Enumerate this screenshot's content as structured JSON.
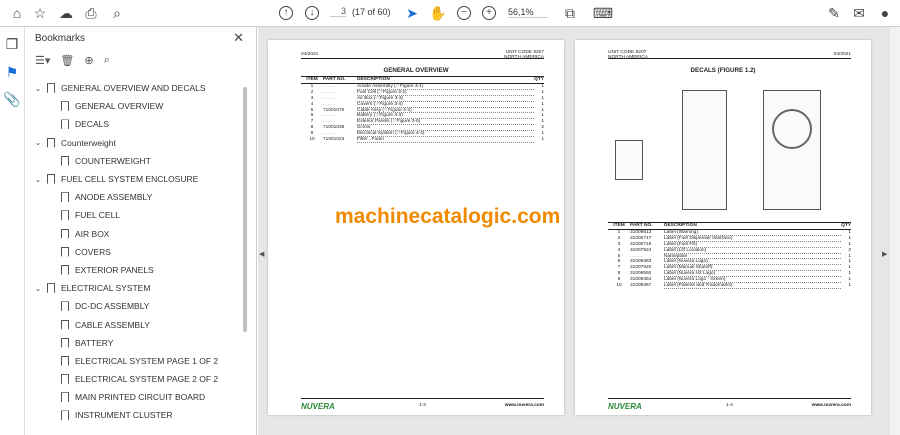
{
  "toolbar": {
    "page_current": "3",
    "page_count": "(17 of 60)",
    "zoom": "56,1%"
  },
  "bookmarks": {
    "title": "Bookmarks",
    "items": [
      {
        "label": "GENERAL OVERVIEW AND DECALS",
        "level": 0
      },
      {
        "label": "GENERAL OVERVIEW",
        "level": 1
      },
      {
        "label": "DECALS",
        "level": 1
      },
      {
        "label": "Counterweight",
        "level": 0
      },
      {
        "label": "COUNTERWEIGHT",
        "level": 1
      },
      {
        "label": "FUEL CELL SYSTEM ENCLOSURE",
        "level": 0
      },
      {
        "label": "ANODE ASSEMBLY",
        "level": 1
      },
      {
        "label": "FUEL CELL",
        "level": 1
      },
      {
        "label": "AIR BOX",
        "level": 1
      },
      {
        "label": "COVERS",
        "level": 1
      },
      {
        "label": "EXTERIOR PANELS",
        "level": 1
      },
      {
        "label": "ELECTRICAL SYSTEM",
        "level": 0
      },
      {
        "label": "DC-DC ASSEMBLY",
        "level": 1
      },
      {
        "label": "CABLE ASSEMBLY",
        "level": 1
      },
      {
        "label": "BATTERY",
        "level": 1
      },
      {
        "label": "ELECTRICAL SYSTEM PAGE 1 OF 2",
        "level": 1
      },
      {
        "label": "ELECTRICAL SYSTEM PAGE 2 OF 2",
        "level": 1
      },
      {
        "label": "MAIN PRINTED CIRCUIT BOARD",
        "level": 1
      },
      {
        "label": "INSTRUMENT CLUSTER",
        "level": 1
      }
    ]
  },
  "columns": {
    "item": "ITEM",
    "part": "PART NO.",
    "desc": "DESCRIPTION",
    "qty": "QTY"
  },
  "left_page": {
    "date": "04/2021",
    "unit_code": "UNIT CODE 8207",
    "region": "NORTH AMERICA",
    "title": "GENERAL OVERVIEW",
    "page_no": "1-3",
    "logo": "NUVERA",
    "url": "www.nuvera.com",
    "rows": [
      [
        "1",
        ". . . . .",
        "Anode Assembly (☞Figure 3-1)",
        "1"
      ],
      [
        "2",
        ". . . . .",
        "Fuel Cell (☞Figure 3-2)",
        "1"
      ],
      [
        "3",
        ". . . . .",
        "Air Box (☞Figure 3-3)",
        "1"
      ],
      [
        "4",
        ". . . . .",
        "Covers (☞Figure 3-4)",
        "1"
      ],
      [
        "5",
        "71001070",
        "Cable Assy (☞Figure 4-2)",
        "1"
      ],
      [
        "6",
        ". . . . .",
        "Battery (☞Figure 4-3)",
        "1"
      ],
      [
        "7",
        ". . . . .",
        "Exterior Panels (☞Figure 3-5)",
        "1"
      ],
      [
        "8",
        "71001039",
        "Screw",
        "2"
      ],
      [
        "9",
        ". . . . .",
        "Electrical System (☞Figure 4-4)",
        "1"
      ],
      [
        "10",
        "71001023",
        "Filter , Foam",
        "1"
      ]
    ]
  },
  "right_page": {
    "date": "04/2021",
    "unit_code": "UNIT CODE 8207",
    "region": "NORTH AMERICA",
    "title": "DECALS (FIGURE 1.2)",
    "page_no": "1-4",
    "logo": "NUVERA",
    "url": "www.nuvera.com",
    "rows": [
      [
        "1",
        "31009613",
        "Label (Warning)",
        "1"
      ],
      [
        "2",
        "31000717",
        "Label (Fuel Dispenser Interface)",
        "1"
      ],
      [
        "3",
        "31000716",
        "Label (Fuel Fill)",
        "1"
      ],
      [
        "4",
        "31007924",
        "Label (Lift Location)",
        "2"
      ],
      [
        "5",
        ". . . . .",
        "Nameplate",
        "1"
      ],
      [
        "6",
        "31009363",
        "Label (Nuvera Logo)",
        "1"
      ],
      [
        "7",
        "31007920",
        "Label (Manual Shutoff)",
        "1"
      ],
      [
        "8",
        "31009592",
        "Label (Nuvera H2 Logo)",
        "1"
      ],
      [
        "9",
        "31009364",
        "Label (Nuvera Logo - Green)",
        "1"
      ],
      [
        "10",
        "31009367",
        "Label (Patents and Trademarks)",
        "1"
      ]
    ]
  },
  "watermark": "machinecatalogic.com",
  "colors": {
    "watermark": "#f08a00",
    "logo": "#2a8a3a",
    "select_tool": "#1a6fd6"
  }
}
